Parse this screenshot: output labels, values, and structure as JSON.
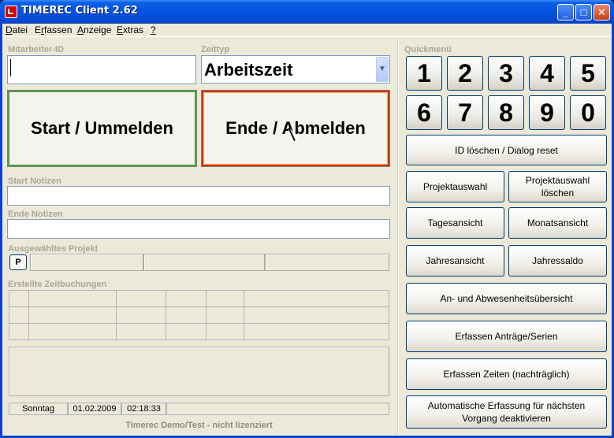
{
  "window": {
    "title": "TIMEREC Client 2.62",
    "controls": {
      "minimize": "_",
      "maximize": "□",
      "close": "✕"
    }
  },
  "menu": [
    {
      "pre": "",
      "u": "D",
      "post": "atei"
    },
    {
      "pre": "E",
      "u": "r",
      "post": "fassen"
    },
    {
      "pre": "",
      "u": "A",
      "post": "nzeige"
    },
    {
      "pre": "",
      "u": "E",
      "post": "xtras"
    },
    {
      "pre": "",
      "u": "?",
      "post": ""
    }
  ],
  "form": {
    "employee_label": "Mitarbeiter-ID",
    "employee_value": "",
    "timetype_label": "Zeittyp",
    "timetype_value": "Arbeitszeit",
    "start_button": "Start / Ummelden",
    "end_button": "Ende / Abmelden",
    "start_notes_label": "Start Notizen",
    "end_notes_label": "Ende Notizen",
    "project_label": "Ausgewähltes Projekt",
    "project_button": "P",
    "bookings_label": "Erstellte Zeitbuchungen"
  },
  "status": {
    "day": "Sonntag",
    "date": "01.02.2009",
    "time": "02:18:33",
    "license_note": "Timerec Demo/Test - nicht lizenziert"
  },
  "quickmenu": {
    "label": "Quickmenü",
    "digits": [
      "1",
      "2",
      "3",
      "4",
      "5",
      "6",
      "7",
      "8",
      "9",
      "0"
    ],
    "reset": "ID löschen / Dialog reset",
    "project_select": "Projektauswahl",
    "project_clear": "Projektauswahl löschen",
    "day_view": "Tagesansicht",
    "month_view": "Monatsansicht",
    "year_view": "Jahresansicht",
    "year_balance": "Jahressaldo",
    "presence_overview": "An- und Abwesenheitsübersicht",
    "requests": "Erfassen Anträge/Serien",
    "times_later": "Erfassen Zeiten (nachträglich)",
    "auto_capture": "Automatische Erfassung für nächsten Vorgang deaktivieren"
  }
}
